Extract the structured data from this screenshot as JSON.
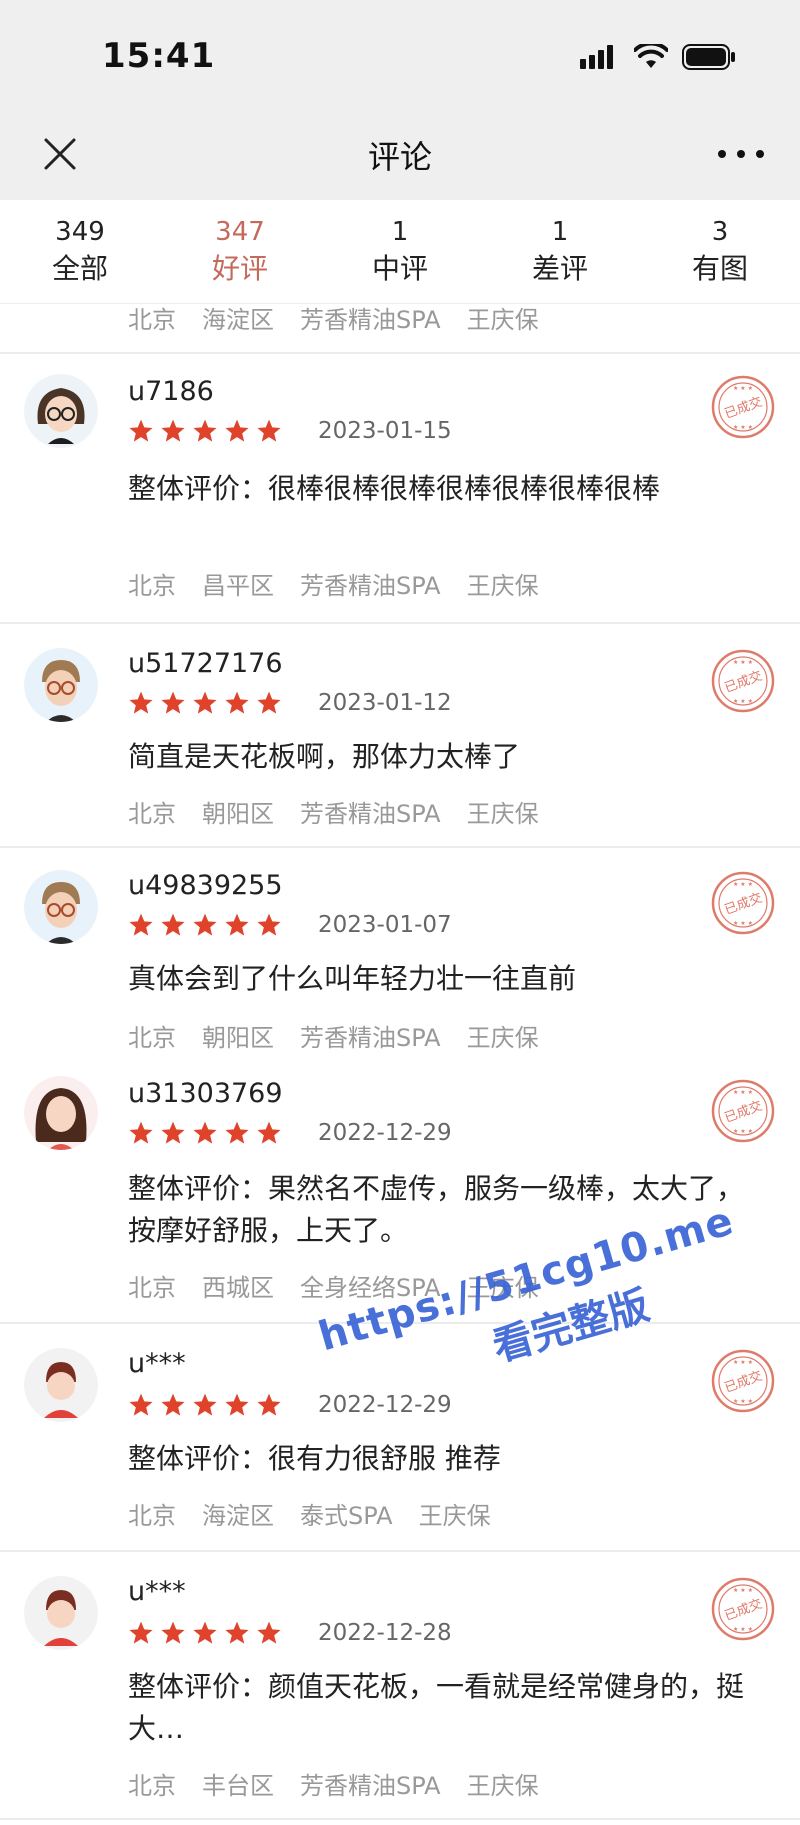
{
  "status_bar": {
    "time": "15:41"
  },
  "navbar": {
    "title": "评论",
    "close_icon": "close-icon",
    "more_icon": "more-icon"
  },
  "tabs": [
    {
      "count": "349",
      "label": "全部",
      "active": false
    },
    {
      "count": "347",
      "label": "好评",
      "active": true
    },
    {
      "count": "1",
      "label": "中评",
      "active": false
    },
    {
      "count": "1",
      "label": "差评",
      "active": false
    },
    {
      "count": "3",
      "label": "有图",
      "active": false
    }
  ],
  "previous_review_meta": {
    "city": "北京",
    "district": "海淀区",
    "service": "芳香精油SPA",
    "staff": "王庆保"
  },
  "colors": {
    "accent": "#c46a5c",
    "star": "#e0432b",
    "stamp": "#e07a6a",
    "watermark": "#3a63d6"
  },
  "reviews": [
    {
      "username": "u7186",
      "rating": 5,
      "date": "2023-01-15",
      "content": "整体评价：很棒很棒很棒很棒很棒很棒很棒",
      "city": "北京",
      "district": "昌平区",
      "service": "芳香精油SPA",
      "staff": "王庆保",
      "stamp": "已成交",
      "avatar": "avatar-girl-glasses"
    },
    {
      "username": "u51727176",
      "rating": 5,
      "date": "2023-01-12",
      "content": "简直是天花板啊，那体力太棒了",
      "city": "北京",
      "district": "朝阳区",
      "service": "芳香精油SPA",
      "staff": "王庆保",
      "stamp": "已成交",
      "avatar": "avatar-boy-glasses"
    },
    {
      "username": "u49839255",
      "rating": 5,
      "date": "2023-01-07",
      "content": "真体会到了什么叫年轻力壮一往直前",
      "city": "北京",
      "district": "朝阳区",
      "service": "芳香精油SPA",
      "staff": "王庆保",
      "stamp": "已成交",
      "avatar": "avatar-boy-glasses"
    },
    {
      "username": "u31303769",
      "rating": 5,
      "date": "2022-12-29",
      "content": "整体评价：果然名不虚传，服务一级棒，太大了，按摩好舒服，上天了。",
      "city": "北京",
      "district": "西城区",
      "service": "全身经络SPA",
      "staff": "王庆保",
      "stamp": "已成交",
      "avatar": "avatar-girl-longhair"
    },
    {
      "username": "u***",
      "rating": 5,
      "date": "2022-12-29",
      "content": "整体评价：很有力很舒服 推荐",
      "city": "北京",
      "district": "海淀区",
      "service": "泰式SPA",
      "staff": "王庆保",
      "stamp": "已成交",
      "avatar": "avatar-default"
    },
    {
      "username": "u***",
      "rating": 5,
      "date": "2022-12-28",
      "content": "整体评价：颜值天花板，一看就是经常健身的，挺大…",
      "city": "北京",
      "district": "丰台区",
      "service": "芳香精油SPA",
      "staff": "王庆保",
      "stamp": "已成交",
      "avatar": "avatar-default"
    }
  ],
  "watermark": {
    "line1": "https://51cg10.me",
    "line2": "看完整版"
  }
}
